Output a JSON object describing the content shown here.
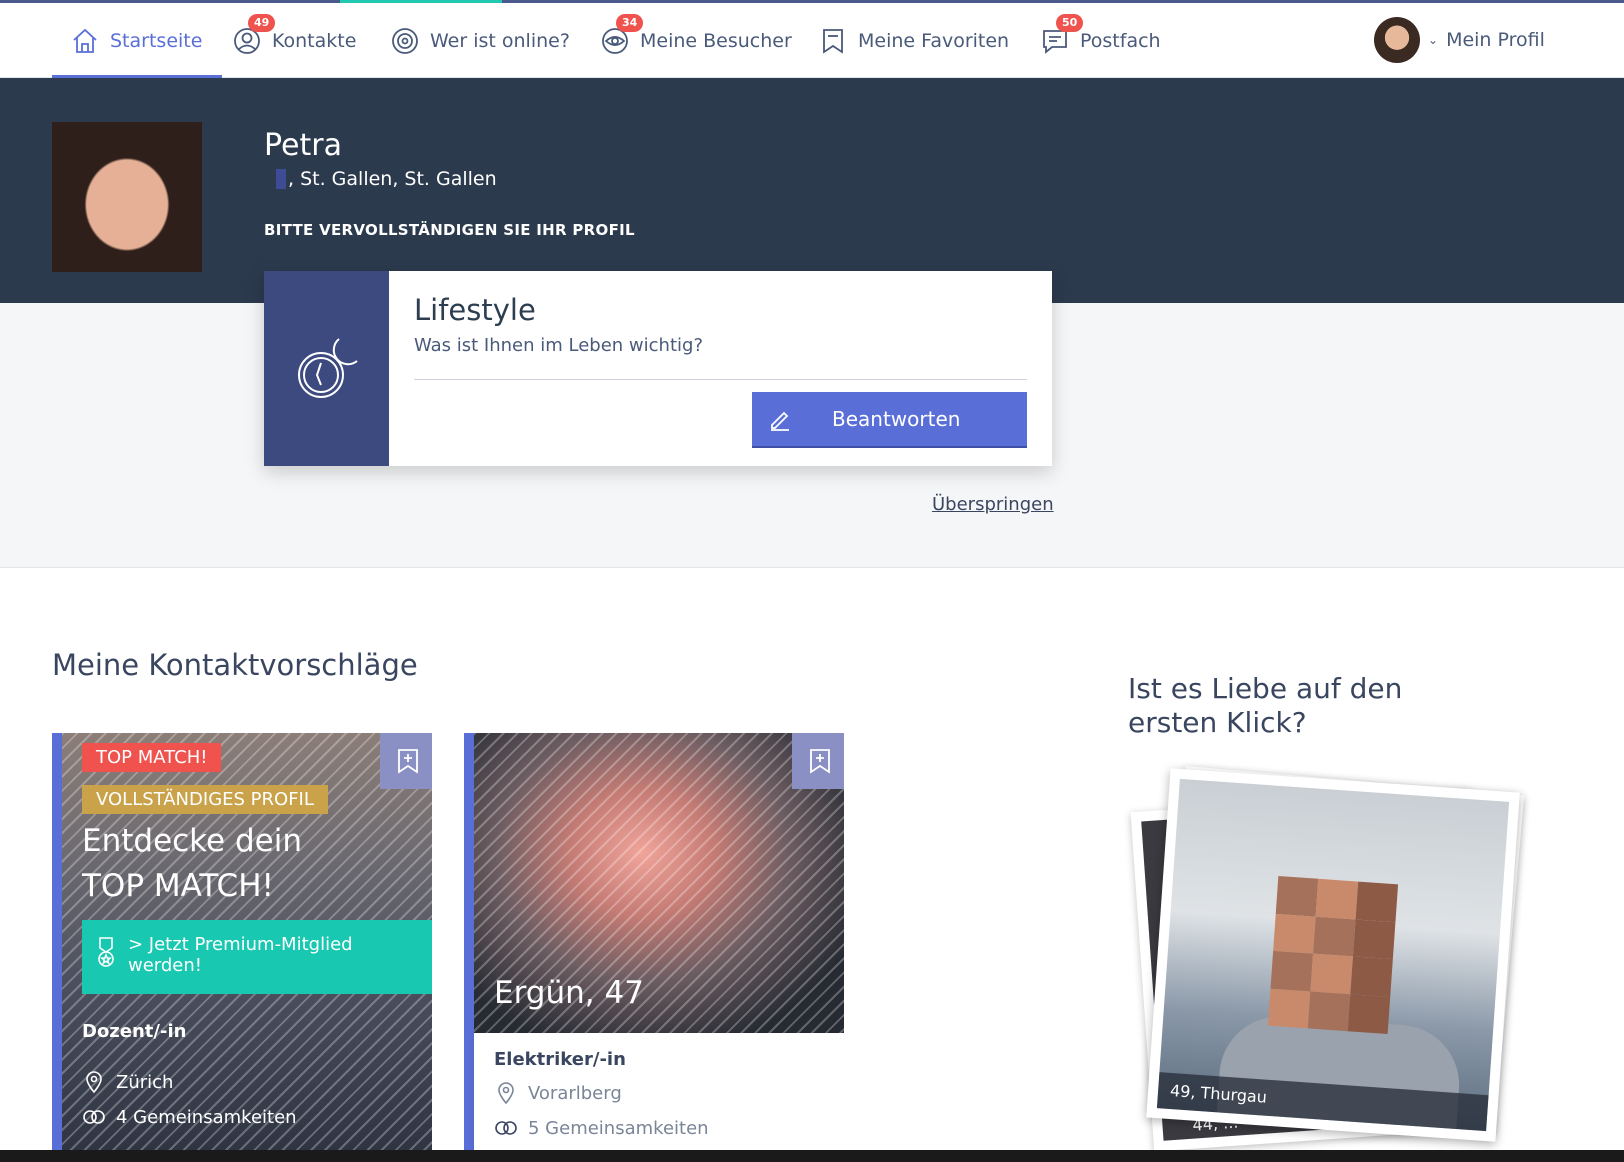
{
  "nav": {
    "items": [
      {
        "label": "Startseite",
        "badge": null,
        "icon": "home-icon"
      },
      {
        "label": "Kontakte",
        "badge": "49",
        "icon": "user-circle-icon"
      },
      {
        "label": "Wer ist online?",
        "badge": null,
        "icon": "online-target-icon"
      },
      {
        "label": "Meine Besucher",
        "badge": "34",
        "icon": "eye-icon"
      },
      {
        "label": "Meine Favoriten",
        "badge": null,
        "icon": "bookmark-icon"
      },
      {
        "label": "Postfach",
        "badge": "50",
        "icon": "message-icon"
      }
    ],
    "profile_label": "Mein Profil"
  },
  "hero": {
    "name": "Petra",
    "location": ", St. Gallen, St. Gallen",
    "prompt": "BITTE VERVOLLSTÄNDIGEN SIE IHR PROFIL"
  },
  "question_card": {
    "title": "Lifestyle",
    "subtitle": "Was ist Ihnen im Leben wichtig?",
    "answer_label": "Beantworten",
    "skip_label": "Überspringen"
  },
  "suggestions": {
    "title": "Meine Kontaktvorschläge",
    "cards": [
      {
        "tag_top": "TOP MATCH!",
        "tag_complete": "VOLLSTÄNDIGES PROFIL",
        "headline_line1": "Entdecke dein",
        "headline_line2": "TOP MATCH!",
        "premium_label_line1": "> Jetzt Premium-Mitglied",
        "premium_label_line2": "werden!",
        "job": "Dozent/-in",
        "location": "Zürich",
        "common": "4 Gemeinsamkeiten"
      },
      {
        "name_age": "Ergün, 47",
        "job": "Elektriker/-in",
        "location": "Vorarlberg",
        "common": "5 Gemeinsamkeiten"
      }
    ]
  },
  "love_click": {
    "title": "Ist es Liebe auf den ersten Klick?",
    "caption_main": "49, Thurgau",
    "caption_back": "44, ..."
  },
  "colors": {
    "accent": "#5a6ed8",
    "hero_bg": "#2c3a4e",
    "badge": "#f0524e",
    "premium": "#18c8b0",
    "gold": "#c9a24a"
  }
}
